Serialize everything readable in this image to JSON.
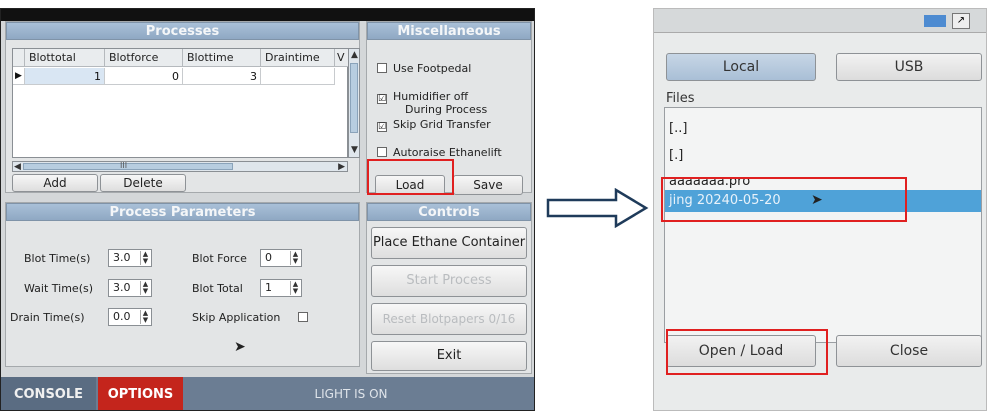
{
  "left_screen": {
    "processes": {
      "title": "Processes",
      "columns": [
        "Blottotal",
        "Blotforce",
        "Blottime",
        "Draintime",
        "V"
      ],
      "row": [
        "1",
        "0",
        "3",
        "",
        ""
      ],
      "h_scroll_label": "III",
      "add_label": "Add",
      "delete_label": "Delete"
    },
    "misc": {
      "title": "Miscellaneous",
      "use_footpedal": "Use Footpedal",
      "humidifier_line1": "Humidifier off",
      "humidifier_line2": "During Process",
      "skip_grid": "Skip Grid Transfer",
      "autoraise": "Autoraise Ethanelift",
      "check_mark": "☑",
      "load_label": "Load",
      "save_label": "Save"
    },
    "params": {
      "title": "Process Parameters",
      "blot_time_label": "Blot Time(s)",
      "blot_time_value": "3.0",
      "wait_time_label": "Wait Time(s)",
      "wait_time_value": "3.0",
      "drain_time_label": "Drain Time(s)",
      "drain_time_value": "0.0",
      "blot_force_label": "Blot Force",
      "blot_force_value": "0",
      "blot_total_label": "Blot Total",
      "blot_total_value": "1",
      "skip_application_label": "Skip Application"
    },
    "controls": {
      "title": "Controls",
      "place_ethane": "Place Ethane Container",
      "start_process": "Start Process",
      "reset_blotpapers": "Reset Blotpapers 0/16",
      "exit": "Exit"
    },
    "bottom": {
      "console": "CONSOLE",
      "options": "OPTIONS",
      "light_status": "LIGHT IS ON"
    }
  },
  "right_screen": {
    "local_label": "Local",
    "usb_label": "USB",
    "files_label": "Files",
    "files": [
      "[..]",
      "[.]",
      "aaaaaaa.pro",
      "jing 20240-05-20"
    ],
    "open_load_label": "Open / Load",
    "close_label": "Close"
  },
  "colors": {
    "highlight_red": "#e02020",
    "options_red": "#c4251c",
    "panel_header_blue": "#9bb3cc",
    "selection_blue": "#4fa2d8"
  },
  "icons": [
    "checkbox-icon",
    "spin-arrows-icon",
    "arrow-right-icon",
    "mouse-cursor-icon"
  ]
}
